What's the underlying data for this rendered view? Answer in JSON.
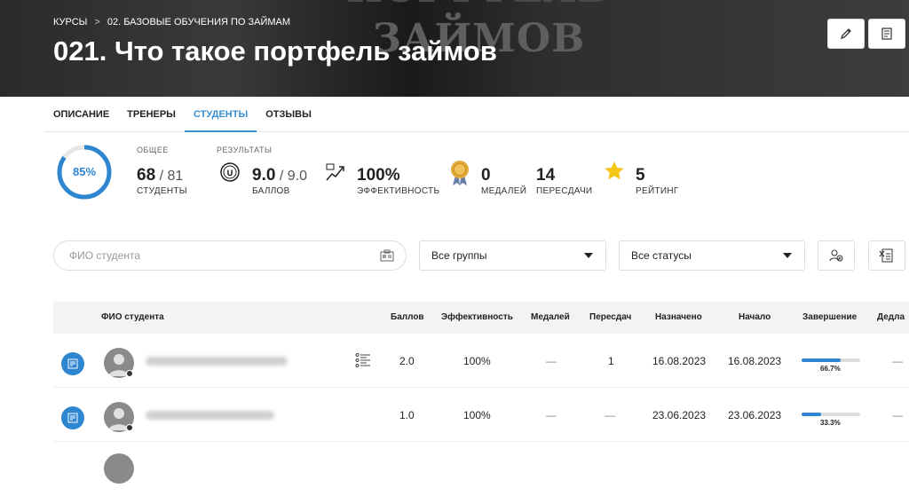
{
  "breadcrumb": {
    "item1": "КУРСЫ",
    "separator": ">",
    "item2": "02. БАЗОВЫЕ ОБУЧЕНИЯ ПО ЗАЙМАМ"
  },
  "page_title": "021. Что такое портфель займов",
  "hero_image_text": {
    "line1": "ПОРТФЕЛЬ",
    "line2": "ЗАЙМОВ"
  },
  "tabs": [
    {
      "label": "ОПИСАНИЕ",
      "active": false
    },
    {
      "label": "ТРЕНЕРЫ",
      "active": false
    },
    {
      "label": "СТУДЕНТЫ",
      "active": true
    },
    {
      "label": "ОТЗЫВЫ",
      "active": false
    }
  ],
  "stats": {
    "progress": {
      "value_label": "85%",
      "fraction": 0.85
    },
    "general": {
      "header": "ОБЩЕЕ",
      "value": "68",
      "total": "81",
      "caption": "СТУДЕНТЫ"
    },
    "results": {
      "header": "РЕЗУЛЬТАТЫ"
    },
    "score": {
      "value": "9.0",
      "total": "9.0",
      "caption": "БАЛЛОВ"
    },
    "efficiency": {
      "value": "100%",
      "caption": "ЭФФЕКТИВНОСТЬ"
    },
    "medals": {
      "value": "0",
      "caption": "МЕДАЛЕЙ"
    },
    "retakes": {
      "value": "14",
      "caption": "ПЕРЕСДАЧИ"
    },
    "rating": {
      "value": "5",
      "caption": "РЕЙТИНГ"
    }
  },
  "filters": {
    "search_placeholder": "ФИО студента",
    "group_select": "Все группы",
    "status_select": "Все статусы"
  },
  "table": {
    "headers": {
      "name": "ФИО студента",
      "score": "Баллов",
      "efficiency": "Эффективность",
      "medals": "Медалей",
      "retakes": "Пересдач",
      "assigned": "Назначено",
      "start": "Начало",
      "completion": "Завершение",
      "deadline": "Дедла"
    },
    "rows": [
      {
        "score": "2.0",
        "efficiency": "100%",
        "medals": "—",
        "retakes": "1",
        "assigned": "16.08.2023",
        "start": "16.08.2023",
        "completion_label": "66.7%",
        "completion_fraction": 0.667,
        "deadline": "—"
      },
      {
        "score": "1.0",
        "efficiency": "100%",
        "medals": "—",
        "retakes": "—",
        "assigned": "23.06.2023",
        "start": "23.06.2023",
        "completion_label": "33.3%",
        "completion_fraction": 0.333,
        "deadline": "—"
      }
    ]
  },
  "colors": {
    "accent": "#2e86d1",
    "active_tab": "#3a8fd0",
    "star": "#f5c518",
    "medal": "#e2a93a"
  }
}
